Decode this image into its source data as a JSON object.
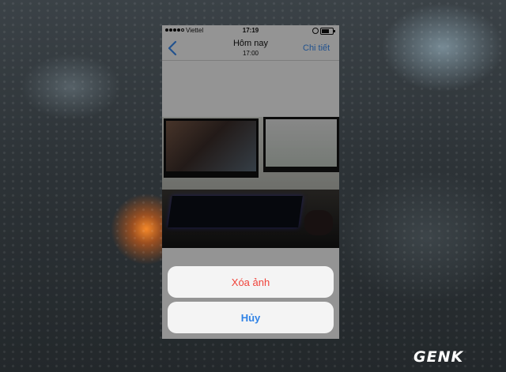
{
  "status_bar": {
    "carrier": "Viettel",
    "time": "17:19"
  },
  "nav": {
    "back_icon": "chevron-left-icon",
    "title": "Hôm nay",
    "subtitle": "17:00",
    "detail_label": "Chi tiết"
  },
  "action_sheet": {
    "delete_label": "Xóa ảnh",
    "cancel_label": "Hủy"
  },
  "colors": {
    "destructive": "#f0433a",
    "accent": "#2f82e6",
    "nav_link": "#3b8ef5"
  },
  "watermark": {
    "text": "GENK"
  }
}
